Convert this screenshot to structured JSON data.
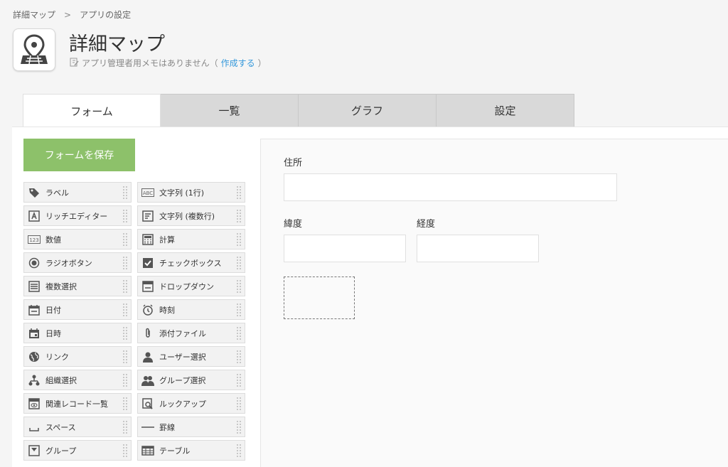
{
  "breadcrumb": {
    "app": "詳細マップ",
    "sep": ">",
    "current": "アプリの設定"
  },
  "app": {
    "title": "詳細マップ",
    "memo_text": "アプリ管理者用メモはありません（",
    "memo_link": "作成する",
    "memo_end": "）"
  },
  "tabs": [
    "フォーム",
    "一覧",
    "グラフ",
    "設定"
  ],
  "save_button": "フォームを保存",
  "palette": [
    "ラベル",
    "文字列 (1行)",
    "リッチエディター",
    "文字列 (複数行)",
    "数値",
    "計算",
    "ラジオボタン",
    "チェックボックス",
    "複数選択",
    "ドロップダウン",
    "日付",
    "時刻",
    "日時",
    "添付ファイル",
    "リンク",
    "ユーザー選択",
    "組織選択",
    "グループ選択",
    "関連レコード一覧",
    "ルックアップ",
    "スペース",
    "罫線",
    "グループ",
    "テーブル"
  ],
  "form": {
    "address_label": "住所",
    "lat_label": "緯度",
    "lng_label": "経度"
  },
  "colors": {
    "save_bg": "#8dc16a",
    "link": "#3498db"
  }
}
